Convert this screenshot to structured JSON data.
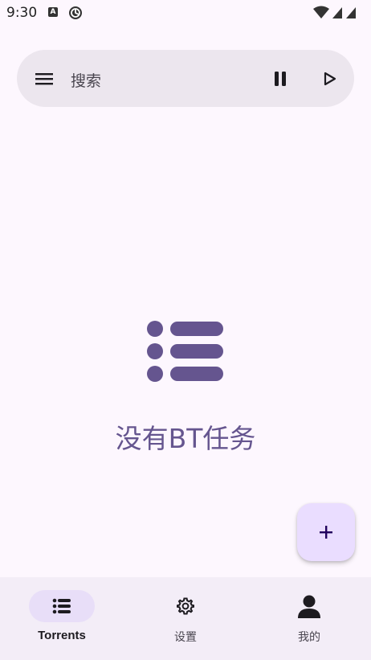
{
  "status_bar": {
    "time": "9:30",
    "notification_letter": "A",
    "icons": [
      "app-notification-icon",
      "sync-icon",
      "wifi-icon",
      "cell-signal-icon",
      "battery-icon"
    ]
  },
  "search_bar": {
    "placeholder": "搜索",
    "icons": [
      "menu-icon",
      "pause-icon",
      "play-icon"
    ]
  },
  "empty_state": {
    "message": "没有BT任务",
    "icon": "list-icon"
  },
  "fab": {
    "icon": "add-icon"
  },
  "bottom_nav": {
    "items": [
      {
        "label": "Torrents",
        "icon": "list-icon",
        "selected": true
      },
      {
        "label": "设置",
        "icon": "gear-icon",
        "selected": false
      },
      {
        "label": "我的",
        "icon": "person-icon",
        "selected": false
      }
    ]
  },
  "colors": {
    "background": "#fdf7fe",
    "search_bar": "#ece6ee",
    "accent": "#65558f",
    "fab": "#eaddff",
    "nav_background": "#f3edf7",
    "nav_active_pill": "#e8def8"
  }
}
